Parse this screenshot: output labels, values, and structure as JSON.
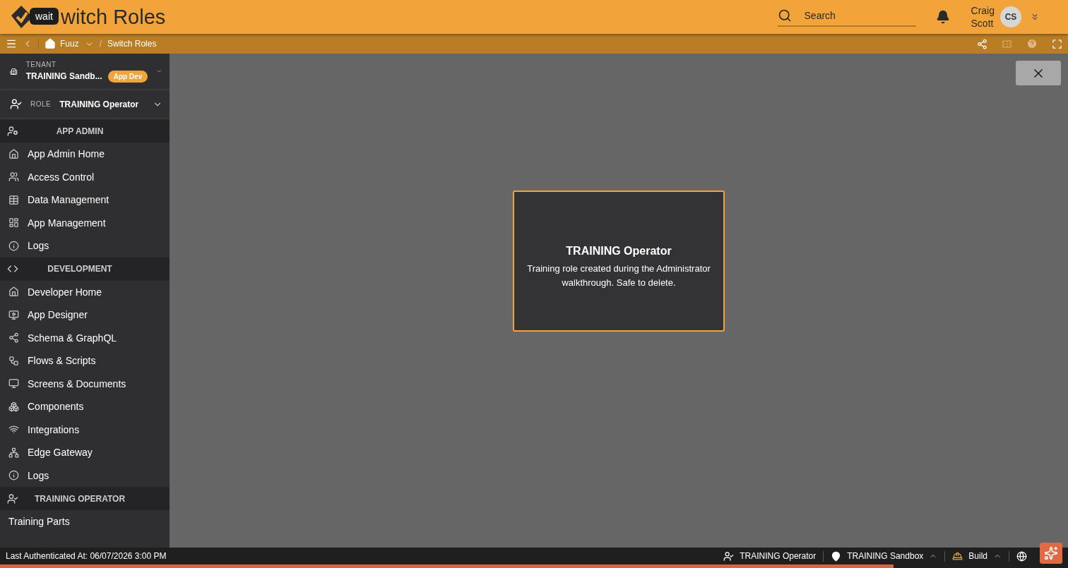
{
  "header": {
    "tooltip": "wait",
    "title": "witch Roles",
    "search": {
      "placeholder": "Search"
    },
    "user": {
      "first_name": "Craig",
      "last_name": "Scott",
      "initials": "CS"
    }
  },
  "breadcrumb": {
    "separator": "/",
    "items": [
      {
        "label": "Fuuz",
        "kind": "home"
      },
      {
        "label": "Switch Roles",
        "kind": "page"
      }
    ]
  },
  "sidebar": {
    "tenant": {
      "label": "TENANT",
      "value": "TRAINING Sandb...",
      "badge": "App Dev"
    },
    "role": {
      "label": "ROLE",
      "value": "TRAINING Operator"
    },
    "sections": [
      {
        "title": "APP ADMIN",
        "items": [
          {
            "label": "App Admin Home"
          },
          {
            "label": "Access Control"
          },
          {
            "label": "Data Management"
          },
          {
            "label": "App Management"
          },
          {
            "label": "Logs"
          }
        ]
      },
      {
        "title": "DEVELOPMENT",
        "items": [
          {
            "label": "Developer Home"
          },
          {
            "label": "App Designer"
          },
          {
            "label": "Schema & GraphQL"
          },
          {
            "label": "Flows & Scripts"
          },
          {
            "label": "Screens & Documents"
          },
          {
            "label": "Components"
          },
          {
            "label": "Integrations"
          },
          {
            "label": "Edge Gateway"
          },
          {
            "label": "Logs"
          }
        ]
      },
      {
        "title": "TRAINING OPERATOR",
        "items": [
          {
            "label": "Training Parts"
          }
        ]
      }
    ]
  },
  "dialog": {
    "title": "TRAINING Operator",
    "description": "Training role created during the Administrator walkthrough. Safe to delete."
  },
  "status_bar": {
    "last_authenticated": "Last Authenticated At: 06/07/2026 3:00 PM",
    "items": [
      {
        "label": "TRAINING Operator",
        "kind": "role"
      },
      {
        "label": "TRAINING Sandbox",
        "kind": "location"
      },
      {
        "label": "Build",
        "kind": "build"
      },
      {
        "kind": "globe"
      }
    ]
  }
}
